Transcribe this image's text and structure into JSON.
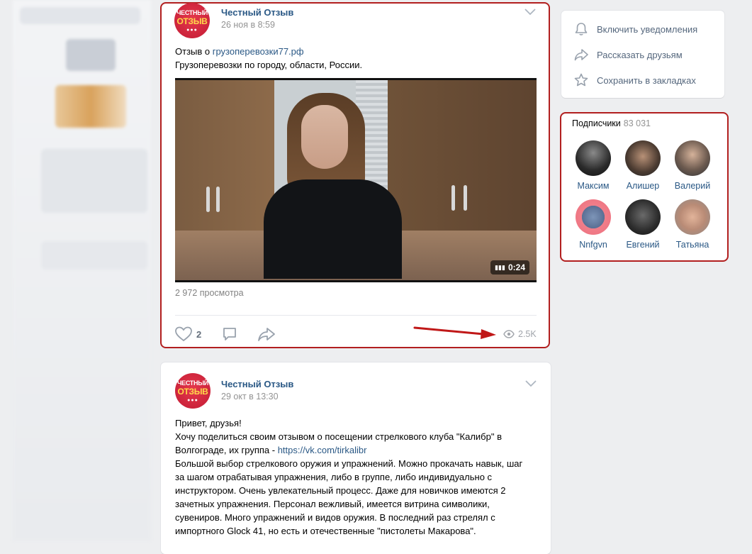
{
  "post1": {
    "author": "Честный Отзыв",
    "logo_line1": "ЧЕСТНЫЙ",
    "logo_line2": "ОТЗЫВ",
    "date": "26 ноя в 8:59",
    "text_prefix": "Отзыв о ",
    "text_link": "грузоперевозки77.рф",
    "text_line2": "Грузоперевозки по городу, области, России.",
    "video_duration": "0:24",
    "video_views": "2 972 просмотра",
    "likes": "2",
    "views": "2.5K"
  },
  "post2": {
    "author": "Честный Отзыв",
    "logo_line1": "ЧЕСТНЫЙ",
    "logo_line2": "ОТЗЫВ",
    "date": "29 окт в 13:30",
    "lines": [
      "Привет, друзья!",
      "Хочу поделиться своим отзывом о посещении стрелкового клуба \"Калибр\" в",
      "Волгограде, их группа - ",
      "Большой выбор стрелкового оружия и упражнений. Можно прокачать навык, шаг",
      "за шагом отрабатывая упражнения, либо в группе, либо индивидуально с",
      "инструктором. Очень увлекательный процесс. Даже для новичков имеются 2",
      "зачетных упражнения. Персонал вежливый, имеется витрина символики,",
      "сувениров. Много упражнений и видов оружия. В последний раз стрелял с",
      "импортного Glock 41, но есть и отечественные \"пистолеты Макарова\"."
    ],
    "link": "https://vk.com/tirkalibr"
  },
  "actions_menu": {
    "notify": "Включить уведомления",
    "share": "Рассказать друзьям",
    "bookmark": "Сохранить в закладках"
  },
  "subscribers": {
    "title": "Подписчики",
    "count": "83 031",
    "people": [
      {
        "name": "Максим"
      },
      {
        "name": "Алишер"
      },
      {
        "name": "Валерий"
      },
      {
        "name": "Nnfgvn"
      },
      {
        "name": "Евгений"
      },
      {
        "name": "Татьяна"
      }
    ]
  },
  "colors": {
    "link": "#2a5885",
    "highlight": "#b21f1f",
    "background": "#edeef0"
  }
}
